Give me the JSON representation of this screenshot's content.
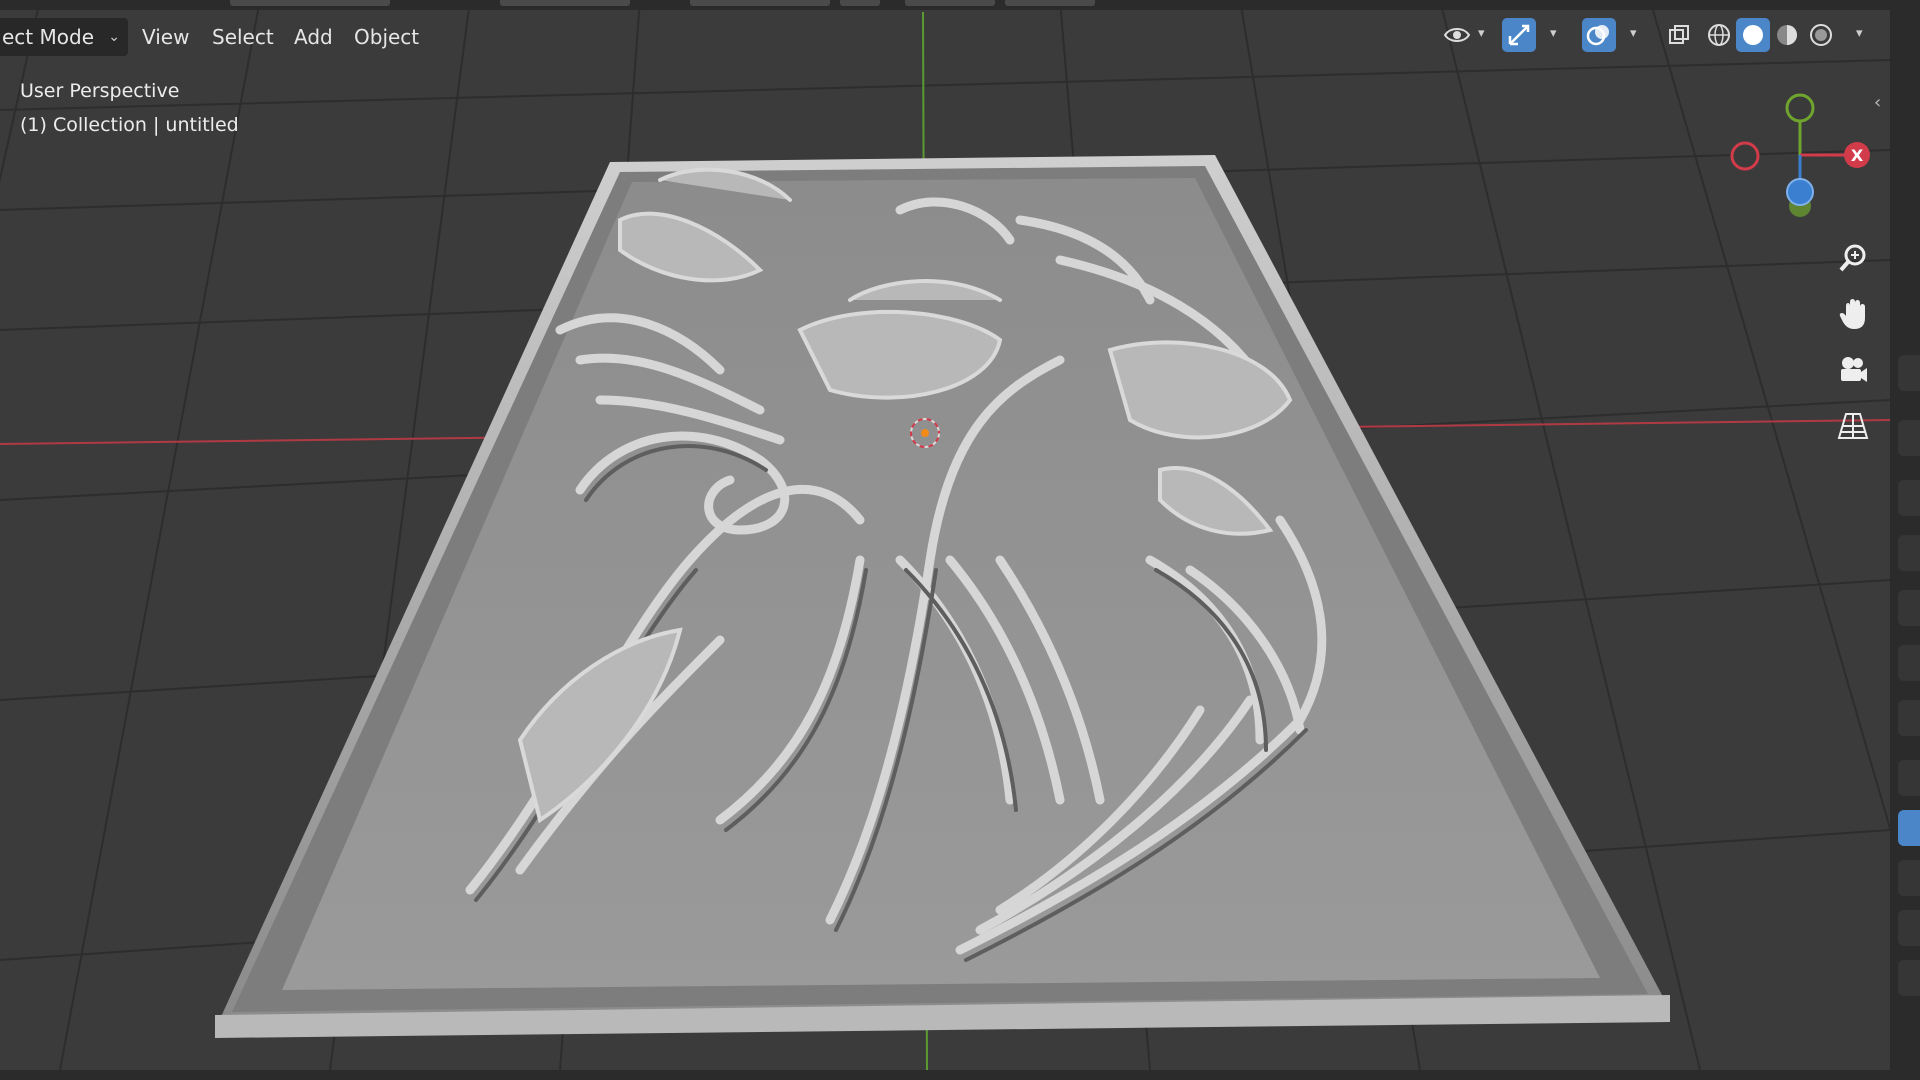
{
  "header": {
    "mode_label": "ect Mode",
    "menus": [
      "View",
      "Select",
      "Add",
      "Object"
    ]
  },
  "viewport": {
    "perspective_label": "User Perspective",
    "collection_label": "(1) Collection | untitled"
  },
  "gizmo": {
    "x_label": "X",
    "colors": {
      "x": "#d13b4a",
      "y": "#6fa52f",
      "z": "#3a7fd0"
    }
  },
  "icons": {
    "toolbar": [
      "visibility-icon",
      "gizmo-icon",
      "overlays-icon",
      "xray-icon",
      "wireframe-shading-icon",
      "solid-shading-icon",
      "material-shading-icon",
      "rendered-shading-icon"
    ],
    "navigation": [
      "zoom-icon",
      "hand-pan-icon",
      "camera-icon",
      "perspective-grid-icon"
    ]
  },
  "colors": {
    "background": "#3b3b3b",
    "grid": "#2c2c2c",
    "x_axis": "#b03a44",
    "y_axis": "#5b9a33",
    "accent": "#4a86c8",
    "model": "#8e8e8e"
  }
}
